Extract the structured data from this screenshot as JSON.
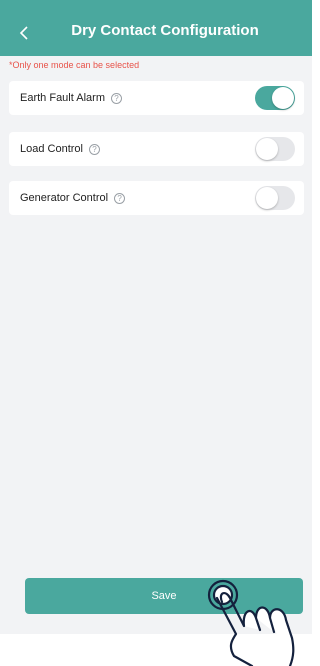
{
  "header": {
    "title": "Dry Contact Configuration",
    "back_icon": "chevron-left-icon"
  },
  "note": "*Only one mode can be selected",
  "modes": [
    {
      "label": "Earth Fault Alarm",
      "enabled": true
    },
    {
      "label": "Load Control",
      "enabled": false
    },
    {
      "label": "Generator Control",
      "enabled": false
    }
  ],
  "help_glyph": "?",
  "save_label": "Save",
  "colors": {
    "accent": "#4aa89e",
    "warning_text": "#e8534a",
    "background": "#f2f3f5"
  }
}
